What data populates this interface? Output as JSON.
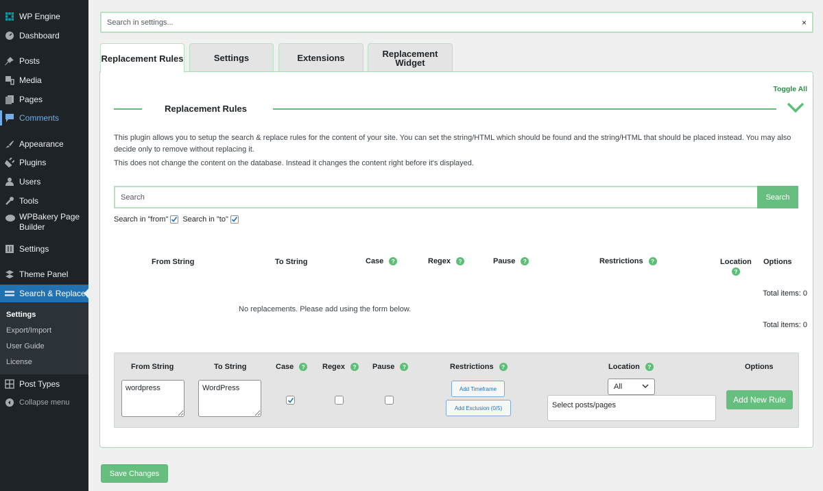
{
  "sidebar": {
    "items": [
      {
        "label": "WP Engine",
        "icon": "wp-engine-icon"
      },
      {
        "label": "Dashboard",
        "icon": "dashboard-icon"
      },
      {
        "label": "Posts",
        "icon": "pin-icon"
      },
      {
        "label": "Media",
        "icon": "media-icon"
      },
      {
        "label": "Pages",
        "icon": "pages-icon"
      },
      {
        "label": "Comments",
        "icon": "comment-icon"
      },
      {
        "label": "Appearance",
        "icon": "brush-icon"
      },
      {
        "label": "Plugins",
        "icon": "plug-icon"
      },
      {
        "label": "Users",
        "icon": "user-icon"
      },
      {
        "label": "Tools",
        "icon": "wrench-icon"
      },
      {
        "label": "WPBakery Page",
        "label2": "Builder",
        "icon": "cloud-icon"
      },
      {
        "label": "Settings",
        "icon": "sliders-icon"
      },
      {
        "label": "Theme Panel",
        "icon": "theme-panel-icon"
      },
      {
        "label": "Search & Replace",
        "icon": "search-replace-icon"
      },
      {
        "label": "Post Types",
        "icon": "grid-icon"
      },
      {
        "label": "Collapse menu",
        "icon": "collapse-icon"
      }
    ],
    "submenu": [
      "Settings",
      "Export/Import",
      "User Guide",
      "License"
    ]
  },
  "settings_search": {
    "placeholder": "Search in settings...",
    "clear": "×"
  },
  "tabs": [
    {
      "label": "Replacement Rules",
      "active": true
    },
    {
      "label": "Settings"
    },
    {
      "label": "Extensions"
    },
    {
      "label": "Replacement Widget"
    }
  ],
  "panel": {
    "toggle_all": "Toggle All",
    "section_title": "Replacement Rules",
    "description_1": "This plugin allows you to setup the search & replace rules for the content of your site. You can set the string/HTML which should be found and the string/HTML that should be placed instead. You may also decide only to remove without replacing it.",
    "description_2": "This does not change the content on the database. Instead it changes the content right before it's displayed.",
    "search": {
      "placeholder": "Search",
      "button": "Search"
    },
    "search_in_from": {
      "label": "Search in \"from\"",
      "checked": true
    },
    "search_in_to": {
      "label": "Search in \"to\"",
      "checked": true
    },
    "table": {
      "columns": [
        "From String",
        "To String",
        "Case",
        "Regex",
        "Pause",
        "Restrictions",
        "Location",
        "Options"
      ],
      "help_icon": "?",
      "total_items_top": "Total items: 0",
      "empty_message": "No replacements. Please add using the form below.",
      "total_items_bottom": "Total items: 0"
    },
    "add_form": {
      "headers": [
        "From String",
        "To String",
        "Case",
        "Regex",
        "Pause",
        "Restrictions",
        "Location",
        "Options"
      ],
      "from_value": "wordpress",
      "to_value": "WordPress",
      "case_checked": true,
      "regex_checked": false,
      "pause_checked": false,
      "add_timeframe": "Add Timeframe",
      "add_exclusion": "Add Exclusion (0/5)",
      "location_selected": "All",
      "posts_placeholder": "Select posts/pages",
      "add_rule": "Add New Rule"
    }
  },
  "save_changes": "Save Changes",
  "colors": {
    "accent_green": "#66bf7e",
    "sidebar_bg": "#1d2327",
    "active_blue": "#2271b1"
  }
}
